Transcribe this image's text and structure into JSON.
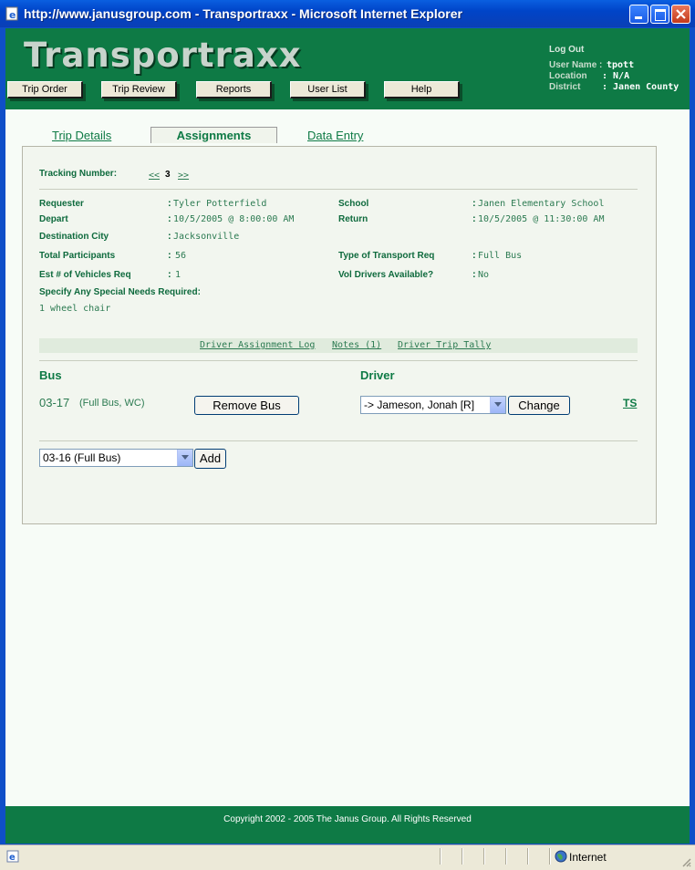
{
  "window": {
    "title": "http://www.janusgroup.com - Transportraxx - Microsoft Internet Explorer"
  },
  "header": {
    "logo": "Transportraxx",
    "nav": [
      "Trip Order",
      "Trip Review",
      "Reports",
      "User List",
      "Help"
    ],
    "logout": "Log Out",
    "user_name_label": "User Name :",
    "user_name": "tpott",
    "location_label": "Location",
    "location": ": N/A",
    "district_label": "District",
    "district": ": Janen County"
  },
  "tabs": {
    "trip_details": "Trip Details",
    "assignments": "Assignments",
    "data_entry": "Data Entry"
  },
  "tracking": {
    "label": "Tracking Number:",
    "prev": "<<",
    "number": "3",
    "next": ">>"
  },
  "fields": {
    "requester_label": "Requester",
    "requester": "Tyler Potterfield",
    "school_label": "School",
    "school": "Janen Elementary School",
    "depart_label": "Depart",
    "depart": "10/5/2005 @ 8:00:00 AM",
    "return_label": "Return",
    "return": "10/5/2005 @ 11:30:00 AM",
    "destination_label": "Destination City",
    "destination": "Jacksonville",
    "participants_label": "Total Participants",
    "participants": "56",
    "transport_label": "Type of Transport Req",
    "transport": "Full Bus",
    "vehicles_label": "Est # of Vehicles Req",
    "vehicles": "1",
    "vol_drivers_label": "Vol Drivers Available?",
    "vol_drivers": "No",
    "special_label": "Specify Any Special Needs Required:",
    "special": "1 wheel chair"
  },
  "links": {
    "assignment_log": "Driver Assignment Log",
    "notes": "Notes (1)",
    "trip_tally": "Driver Trip Tally"
  },
  "assignment": {
    "bus_header": "Bus",
    "driver_header": "Driver",
    "bus_id": "03-17",
    "bus_desc": "(Full Bus, WC)",
    "remove_label": "Remove Bus",
    "driver_selected": "-> Jameson, Jonah [R]",
    "change_label": "Change",
    "ts_label": "TS",
    "add_selected": "03-16 (Full Bus)",
    "add_label": "Add"
  },
  "footer": {
    "copyright": "Copyright 2002 - 2005 The Janus Group. All Rights Reserved"
  },
  "status": {
    "zone": "Internet"
  },
  "colors": {
    "brand_green": "#0e7a45",
    "xp_blue": "#0a5fe0"
  }
}
